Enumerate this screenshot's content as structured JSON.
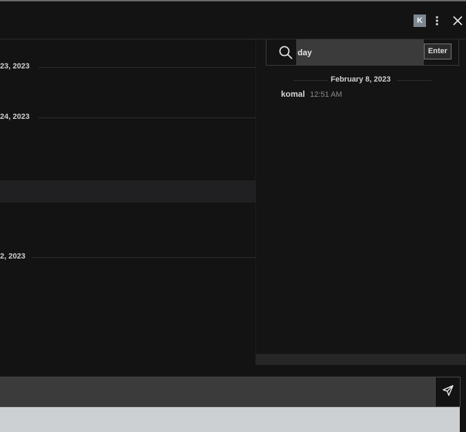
{
  "header": {
    "avatar_initial": "K",
    "menu_icon": "kebab-icon",
    "close_icon": "close-icon"
  },
  "chat": {
    "date_separators": [
      {
        "label": "23, 2023"
      },
      {
        "label": "24, 2023"
      },
      {
        "label": "2, 2023"
      }
    ]
  },
  "search": {
    "icon": "search-icon",
    "value": "day",
    "enter_label": "Enter",
    "results": [
      {
        "date": "February 8, 2023",
        "user": "komal",
        "time": "12:51 AM"
      }
    ]
  },
  "composer": {
    "send_icon": "send-icon"
  },
  "colors": {
    "background": "#131313",
    "input_bg": "#3b3b3b",
    "avatar_bg": "#7d8893"
  }
}
